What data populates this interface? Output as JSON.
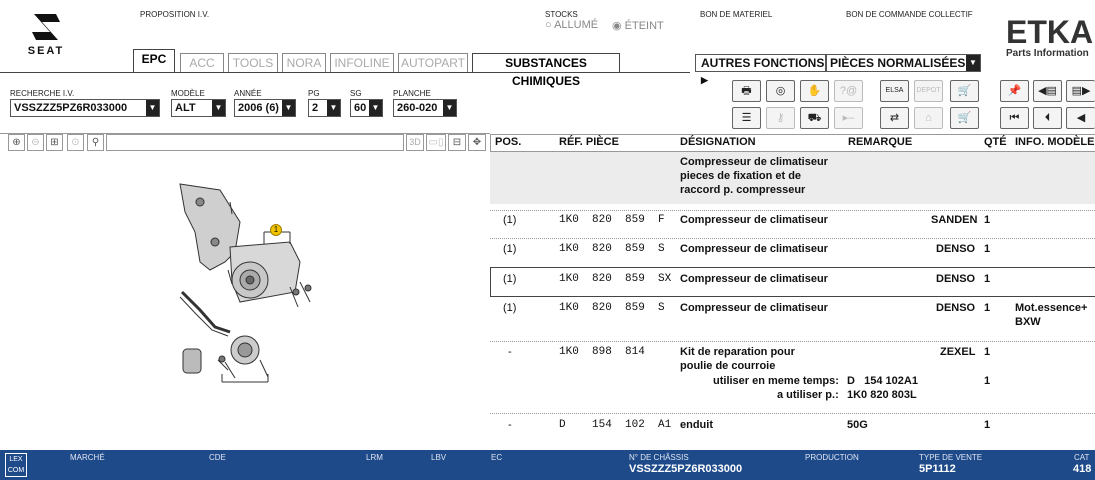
{
  "brand": {
    "seat_label": "SEAT",
    "etka_title": "ETKA",
    "etka_subtitle": "Parts Information"
  },
  "header": {
    "proposition": "PROPOSITION I.V.",
    "stocks_label": "STOCKS",
    "stock_on": "ALLUMÉ",
    "stock_off": "ÉTEINT",
    "bon_materiel": "BON DE MATERIEL",
    "bon_collectif": "BON DE COMMANDE COLLECTIF"
  },
  "tabs": [
    "EPC",
    "ACC",
    "TOOLS",
    "NORA",
    "INFOLINE",
    "AUTOPART",
    "SUBSTANCES CHIMIQUES"
  ],
  "autres": {
    "label": "AUTRES FONCTIONS",
    "arrow": "▶",
    "selected": "PIÈCES NORMALISÉES"
  },
  "filters": {
    "recherche": {
      "label": "RECHERCHE I.V.",
      "value": "VSSZZZ5PZ6R033000"
    },
    "modele": {
      "label": "MODÈLE",
      "value": "ALT"
    },
    "annee": {
      "label": "ANNÉE",
      "value": "2006 (6)"
    },
    "pg": {
      "label": "PG",
      "value": "2"
    },
    "sg": {
      "label": "SG",
      "value": "60"
    },
    "planche": {
      "label": "PLANCHE",
      "value": "260-020"
    }
  },
  "diagram": {
    "label_3d": "3D",
    "callout": "1"
  },
  "table": {
    "headers": {
      "pos": "POS.",
      "ref": "RÉF. PIÈCE",
      "desig": "DÉSIGNATION",
      "remarque": "REMARQUE",
      "qte": "QTÉ",
      "info": "INFO. MODÈLE"
    },
    "title_lines": [
      "Compresseur de climatiseur",
      "pieces de fixation et de",
      "raccord p. compresseur"
    ],
    "rows": [
      {
        "pos": "(1)",
        "ref": "1K0  820  859  F",
        "desig": "Compresseur de climatiseur",
        "remarque": "SANDEN",
        "qte": "1",
        "info": ""
      },
      {
        "pos": "(1)",
        "ref": "1K0  820  859  S",
        "desig": "Compresseur de climatiseur",
        "remarque": "DENSO",
        "qte": "1",
        "info": ""
      },
      {
        "pos": "(1)",
        "ref": "1K0  820  859  SX",
        "desig": "Compresseur de climatiseur",
        "remarque": "DENSO",
        "qte": "1",
        "info": ""
      },
      {
        "pos": "(1)",
        "ref": "1K0  820  859  S",
        "desig": "Compresseur de climatiseur",
        "remarque": "DENSO",
        "qte": "1",
        "info": "Mot.essence+",
        "info2": "BXW"
      },
      {
        "pos": "-",
        "ref": "1K0  898  814",
        "desig": "Kit de reparation pour",
        "desig2": "poulie de courroie",
        "remarque": "ZEXEL",
        "qte": "1",
        "info": ""
      },
      {
        "pos": "-",
        "ref": "D    154  102  A1",
        "desig": "enduit",
        "remarque": "50G",
        "qte": "1",
        "info": ""
      }
    ],
    "sub1": {
      "label": "utiliser en meme temps:",
      "value": "D   154 102A1",
      "qte": "1"
    },
    "sub2": {
      "label": "a utiliser p.:",
      "value": "1K0 820 803L"
    }
  },
  "footer": {
    "lex": "LEX",
    "com": "COM",
    "marche": "MARCHÉ",
    "cde": "CDE",
    "lrm": "LRM",
    "lbv": "LBV",
    "ec": "EC",
    "chassis_label": "N° DE CHÂSSIS",
    "chassis": "VSSZZZ5PZ6R033000",
    "production": "PRODUCTION",
    "type_label": "TYPE DE VENTE",
    "type": "5P1112",
    "cat_label": "CAT",
    "cat": "418"
  },
  "colors": {
    "footer": "#1e4a8a"
  }
}
